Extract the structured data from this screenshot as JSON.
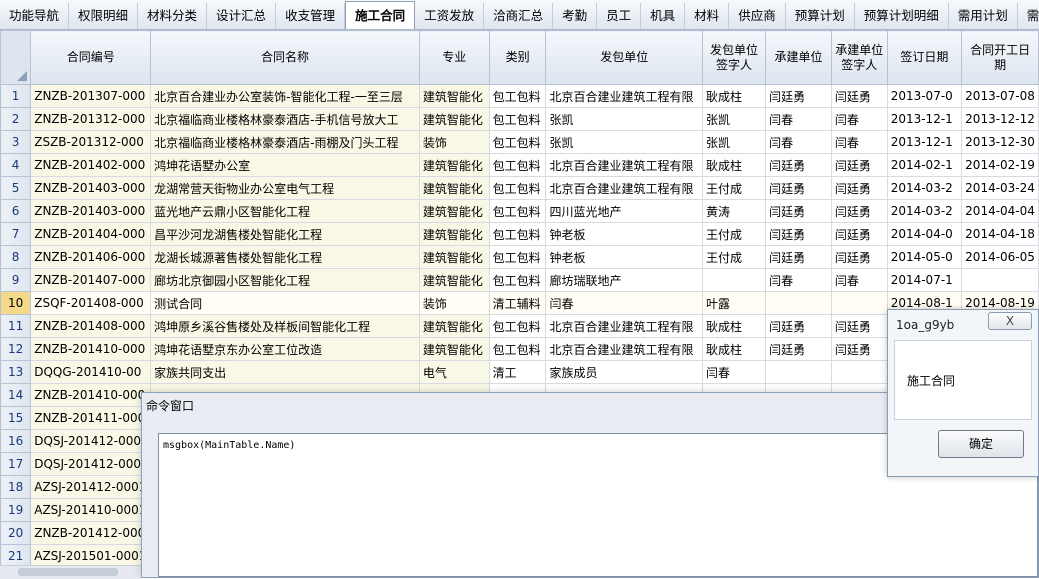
{
  "tabs": [
    "功能导航",
    "权限明细",
    "材料分类",
    "设计汇总",
    "收支管理",
    "施工合同",
    "工资发放",
    "洽商汇总",
    "考勤",
    "员工",
    "机具",
    "材料",
    "供应商",
    "预算计划",
    "预算计划明细",
    "需用计划",
    "需用计划"
  ],
  "active_tab": "施工合同",
  "columns": [
    "合同编号",
    "合同名称",
    "专业",
    "类别",
    "发包单位",
    "发包单位签字人",
    "承建单位",
    "承建单位签字人",
    "签订日期",
    "合同开工日期"
  ],
  "rows": [
    {
      "n": "1",
      "c": [
        "ZNZB-201307-000",
        "北京百合建业办公室装饰-智能化工程-一至三层",
        "建筑智能化",
        "包工包料",
        "北京百合建业建筑工程有限",
        "耿成柱",
        "闫廷勇",
        "闫廷勇",
        "2013-07-0",
        "2013-07-08"
      ]
    },
    {
      "n": "2",
      "c": [
        "ZNZB-201312-000",
        "北京福临商业楼格林豪泰酒店-手机信号放大工",
        "建筑智能化",
        "包工包料",
        "张凯",
        "张凯",
        "闫春",
        "闫春",
        "2013-12-1",
        "2013-12-12"
      ]
    },
    {
      "n": "3",
      "c": [
        "ZSZB-201312-000",
        "北京福临商业楼格林豪泰酒店-雨棚及门头工程",
        "装饰",
        "包工包料",
        "张凯",
        "张凯",
        "闫春",
        "闫春",
        "2013-12-1",
        "2013-12-30"
      ]
    },
    {
      "n": "4",
      "c": [
        "ZNZB-201402-000",
        "鸿坤花语墅办公室",
        "建筑智能化",
        "包工包料",
        "北京百合建业建筑工程有限",
        "耿成柱",
        "闫廷勇",
        "闫廷勇",
        "2014-02-1",
        "2014-02-19"
      ]
    },
    {
      "n": "5",
      "c": [
        "ZNZB-201403-000",
        "龙湖常营天街物业办公室电气工程",
        "建筑智能化",
        "包工包料",
        "北京百合建业建筑工程有限",
        "王付成",
        "闫廷勇",
        "闫廷勇",
        "2014-03-2",
        "2014-03-24"
      ]
    },
    {
      "n": "6",
      "c": [
        "ZNZB-201403-000",
        "蓝光地产云鼎小区智能化工程",
        "建筑智能化",
        "包工包料",
        "四川蓝光地产",
        "黄涛",
        "闫廷勇",
        "闫廷勇",
        "2014-03-2",
        "2014-04-04"
      ]
    },
    {
      "n": "7",
      "c": [
        "ZNZB-201404-000",
        "昌平沙河龙湖售楼处智能化工程",
        "建筑智能化",
        "包工包料",
        "钟老板",
        "王付成",
        "闫廷勇",
        "闫廷勇",
        "2014-04-0",
        "2014-04-18"
      ]
    },
    {
      "n": "8",
      "c": [
        "ZNZB-201406-000",
        "龙湖长城源著售楼处智能化工程",
        "建筑智能化",
        "包工包料",
        "钟老板",
        "王付成",
        "闫廷勇",
        "闫廷勇",
        "2014-05-0",
        "2014-06-05"
      ]
    },
    {
      "n": "9",
      "c": [
        "ZNZB-201407-000",
        "廊坊北京御园小区智能化工程",
        "建筑智能化",
        "包工包料",
        "廊坊瑞联地产",
        "",
        "闫春",
        "闫春",
        "2014-07-1",
        ""
      ]
    },
    {
      "n": "10",
      "c": [
        "ZSQF-201408-000",
        "测试合同",
        "装饰",
        "清工辅料",
        "闫春",
        "叶露",
        "",
        "",
        "2014-08-1",
        "2014-08-19"
      ]
    },
    {
      "n": "11",
      "c": [
        "ZNZB-201408-000",
        "鸿坤原乡溪谷售楼处及样板间智能化工程",
        "建筑智能化",
        "包工包料",
        "北京百合建业建筑工程有限",
        "耿成柱",
        "闫廷勇",
        "闫廷勇",
        "",
        ""
      ]
    },
    {
      "n": "12",
      "c": [
        "ZNZB-201410-000",
        "鸿坤花语墅京东办公室工位改造",
        "建筑智能化",
        "包工包料",
        "北京百合建业建筑工程有限",
        "耿成柱",
        "闫廷勇",
        "闫廷勇",
        "",
        ""
      ]
    },
    {
      "n": "13",
      "c": [
        "DQQG-201410-00",
        "家族共同支出",
        "电气",
        "清工",
        "家族成员",
        "闫春",
        "",
        "",
        "",
        ""
      ]
    },
    {
      "n": "14",
      "c": [
        "ZNZB-201410-000",
        "",
        "",
        "",
        "",
        "",
        "",
        "",
        "",
        ""
      ]
    },
    {
      "n": "15",
      "c": [
        "ZNZB-201411-000",
        "",
        "",
        "",
        "",
        "",
        "",
        "",
        "",
        ""
      ]
    },
    {
      "n": "16",
      "c": [
        "DQSJ-201412-000",
        "",
        "",
        "",
        "",
        "",
        "",
        "",
        "",
        ""
      ]
    },
    {
      "n": "17",
      "c": [
        "DQSJ-201412-000",
        "",
        "",
        "",
        "",
        "",
        "",
        "",
        "",
        ""
      ]
    },
    {
      "n": "18",
      "c": [
        "AZSJ-201412-0001",
        "",
        "",
        "",
        "",
        "",
        "",
        "",
        "",
        ""
      ]
    },
    {
      "n": "19",
      "c": [
        "AZSJ-201410-0001",
        "",
        "",
        "",
        "",
        "",
        "",
        "",
        "",
        ""
      ]
    },
    {
      "n": "20",
      "c": [
        "ZNZB-201412-000",
        "",
        "",
        "",
        "",
        "",
        "",
        "",
        "",
        ""
      ]
    },
    {
      "n": "21",
      "c": [
        "AZSJ-201501-0001",
        "",
        "",
        "",
        "",
        "",
        "",
        "",
        "",
        ""
      ]
    }
  ],
  "command_window": {
    "title": "命令窗口",
    "code": "msgbox(MainTable.Name)"
  },
  "message_box": {
    "title": "1oa_g9yb",
    "close_label": "X",
    "message": "施工合同",
    "ok_label": "确定"
  }
}
